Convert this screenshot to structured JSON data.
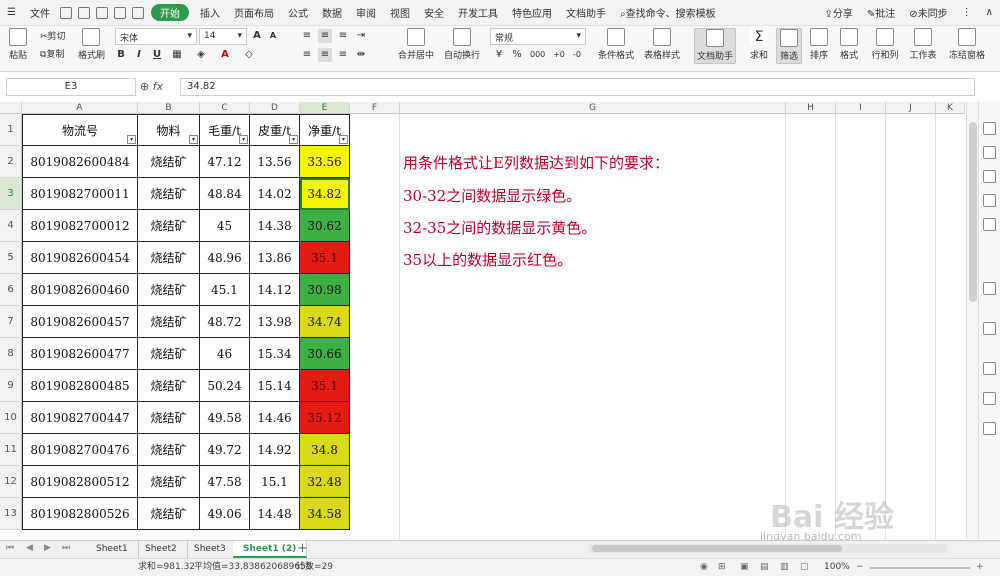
{
  "menubar": {
    "file": "文件",
    "tabs": [
      "开始",
      "插入",
      "页面布局",
      "公式",
      "数据",
      "审阅",
      "视图",
      "安全",
      "开发工具",
      "特色应用",
      "文档助手"
    ],
    "active_tab": "开始",
    "search": "查找命令、搜索模板",
    "share": "分享",
    "comment": "批注",
    "sync": "未同步"
  },
  "ribbon": {
    "paste": "粘贴",
    "cut": "剪切",
    "copy": "复制",
    "format_painter": "格式刷",
    "font_name": "宋体",
    "font_size": "14",
    "bold": "B",
    "italic": "I",
    "underline": "U",
    "merge_center": "合并居中",
    "wrap_text": "自动换行",
    "number_format": "常规",
    "cond_format": "条件格式",
    "table_style": "表格样式",
    "doc_helper": "文档助手",
    "sum": "求和",
    "filter": "筛选",
    "sort": "排序",
    "format": "格式",
    "row_col": "行和列",
    "worksheet": "工作表",
    "freeze": "冻结窗格"
  },
  "formula_bar": {
    "cell_ref": "E3",
    "fx": "fx",
    "value": "34.82"
  },
  "columns": [
    "A",
    "B",
    "C",
    "D",
    "E",
    "F",
    "G",
    "H",
    "I",
    "J",
    "K"
  ],
  "headers": [
    "物流号",
    "物料",
    "毛重/t",
    "皮重/t",
    "净重/t"
  ],
  "rows": [
    {
      "num": "2",
      "id": "8019082600484",
      "mat": "烧结矿",
      "gross": "47.12",
      "tare": "13.56",
      "net": "33.56",
      "color": "#f5f500"
    },
    {
      "num": "3",
      "id": "8019082700011",
      "mat": "烧结矿",
      "gross": "48.84",
      "tare": "14.02",
      "net": "34.82",
      "color": "#f5f500"
    },
    {
      "num": "4",
      "id": "8019082700012",
      "mat": "烧结矿",
      "gross": "45",
      "tare": "14.38",
      "net": "30.62",
      "color": "#3cb043"
    },
    {
      "num": "5",
      "id": "8019082600454",
      "mat": "烧结矿",
      "gross": "48.96",
      "tare": "13.86",
      "net": "35.1",
      "color": "#e41b13"
    },
    {
      "num": "6",
      "id": "8019082600460",
      "mat": "烧结矿",
      "gross": "45.1",
      "tare": "14.12",
      "net": "30.98",
      "color": "#3cb043"
    },
    {
      "num": "7",
      "id": "8019082600457",
      "mat": "烧结矿",
      "gross": "48.72",
      "tare": "13.98",
      "net": "34.74",
      "color": "#d9d919"
    },
    {
      "num": "8",
      "id": "8019082600477",
      "mat": "烧结矿",
      "gross": "46",
      "tare": "15.34",
      "net": "30.66",
      "color": "#3cb043"
    },
    {
      "num": "9",
      "id": "8019082800485",
      "mat": "烧结矿",
      "gross": "50.24",
      "tare": "15.14",
      "net": "35.1",
      "color": "#e41b13"
    },
    {
      "num": "10",
      "id": "8019082700447",
      "mat": "烧结矿",
      "gross": "49.58",
      "tare": "14.46",
      "net": "35.12",
      "color": "#e41b13"
    },
    {
      "num": "11",
      "id": "8019082700476",
      "mat": "烧结矿",
      "gross": "49.72",
      "tare": "14.92",
      "net": "34.8",
      "color": "#d9d919"
    },
    {
      "num": "12",
      "id": "8019082800512",
      "mat": "烧结矿",
      "gross": "47.58",
      "tare": "15.1",
      "net": "32.48",
      "color": "#d9d919"
    },
    {
      "num": "13",
      "id": "8019082800526",
      "mat": "烧结矿",
      "gross": "49.06",
      "tare": "14.48",
      "net": "34.58",
      "color": "#d9d919"
    }
  ],
  "notes": [
    "用条件格式让E列数据达到如下的要求：",
    "30-32之间数据显示绿色。",
    "32-35之间的数据显示黄色。",
    "35以上的数据显示红色。"
  ],
  "sheets": [
    "Sheet1",
    "Sheet2",
    "Sheet3",
    "Sheet1 (2)"
  ],
  "active_sheet": "Sheet1 (2)",
  "status": {
    "sum": "求和=981.32",
    "avg": "平均值=33.838620689655",
    "count": "计数=29",
    "zoom": "100%"
  },
  "watermark": {
    "main": "Bai 经验",
    "sub": "jingyan.baidu.com"
  }
}
